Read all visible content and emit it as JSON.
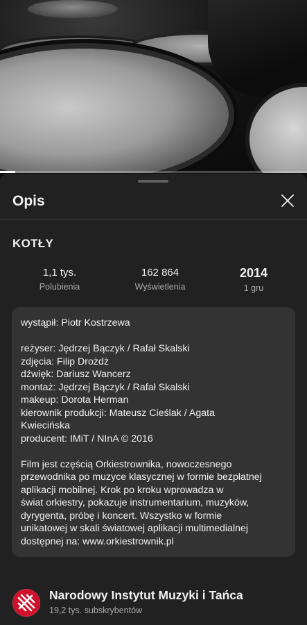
{
  "player": {
    "progress_fraction": 0.05
  },
  "sheet": {
    "title": "Opis",
    "close_icon": "close-icon"
  },
  "video": {
    "title": "KOTŁY",
    "stats": {
      "likes_value": "1,1 tys.",
      "likes_label": "Polubienia",
      "views_value": "162 864",
      "views_label": "Wyświetlenia",
      "year_value": "2014",
      "date_label": "1 gru"
    }
  },
  "description": {
    "lines": [
      "wystąpił: Piotr Kostrzewa",
      "",
      "reżyser: Jędrzej Bączyk / Rafał Skalski",
      "zdjęcia: Filip Drożdż",
      "dźwięk: Dariusz Wancerz",
      "montaż: Jędrzej Bączyk / Rafał Skalski",
      "makeup: Dorota Herman",
      "kierownik produkcji: Mateusz Cieślak / Agata",
      "Kwiecińska",
      "producent: IMiT / NInA © 2016",
      "",
      "Film jest częścią Orkiestrownika, nowoczesnego",
      "przewodnika po muzyce klasycznej w formie bezpłatnej",
      "aplikacji mobilnej. Krok po kroku wprowadza w",
      "świat orkiestry, pokazuje instrumentarium, muzyków,",
      "dyrygenta, próbę i koncert. Wszystko w formie",
      "unikatowej w skali światowej aplikacji multimedialnej",
      "dostępnej na: www.orkiestrownik.pl"
    ]
  },
  "channel": {
    "name": "Narodowy Instytut Muzyki i Tańca",
    "subscribers": "19,2 tys. subskrybentów",
    "avatar_icon": "nimit-logo-icon",
    "brand_color": "#d0112b"
  },
  "colors": {
    "background": "#0f0f0f",
    "sheet": "#212121",
    "description_box": "#333333",
    "secondary_text": "#aaaaaa"
  }
}
